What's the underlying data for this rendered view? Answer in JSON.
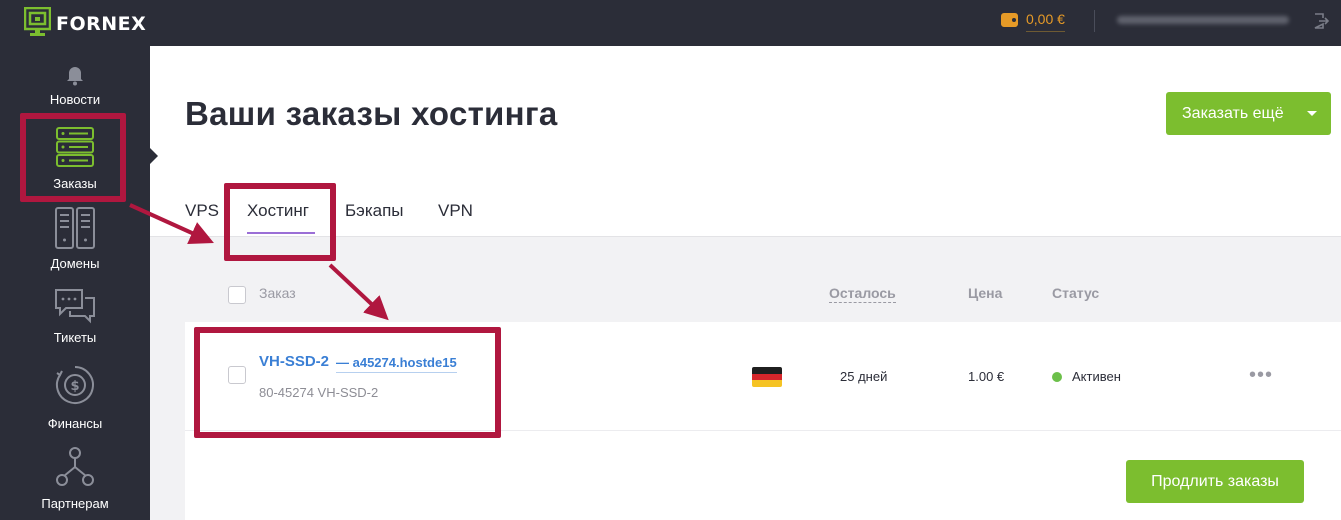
{
  "header": {
    "logo_text": "FORNEX",
    "balance": "0,00 €",
    "accent_color": "#7cbe2f",
    "balance_color": "#e69a27"
  },
  "sidebar": {
    "items": [
      {
        "label": "Новости",
        "icon": "bell-icon"
      },
      {
        "label": "Заказы",
        "icon": "server-icon"
      },
      {
        "label": "Домены",
        "icon": "domains-icon"
      },
      {
        "label": "Тикеты",
        "icon": "chat-icon"
      },
      {
        "label": "Финансы",
        "icon": "finance-icon"
      },
      {
        "label": "Партнерам",
        "icon": "partners-icon"
      }
    ]
  },
  "main": {
    "title": "Ваши заказы хостинга",
    "order_more_label": "Заказать ещё",
    "tabs": [
      {
        "label": "VPS",
        "active": false
      },
      {
        "label": "Хостинг",
        "active": true
      },
      {
        "label": "Бэкапы",
        "active": false
      },
      {
        "label": "VPN",
        "active": false
      }
    ],
    "table": {
      "columns": {
        "order": "Заказ",
        "remaining": "Осталось",
        "price": "Цена",
        "status": "Статус"
      },
      "rows": [
        {
          "name": "VH-SSD-2",
          "domain": "— a45274.hostde15",
          "sub": "80-45274  VH-SSD-2",
          "country_flag": "germany-flag-icon",
          "remaining": "25 дней",
          "price": "1.00 €",
          "status": "Активен",
          "status_color": "#6cc04a"
        }
      ]
    },
    "renew_label": "Продлить заказы"
  },
  "annotation_color": "#b0173f"
}
